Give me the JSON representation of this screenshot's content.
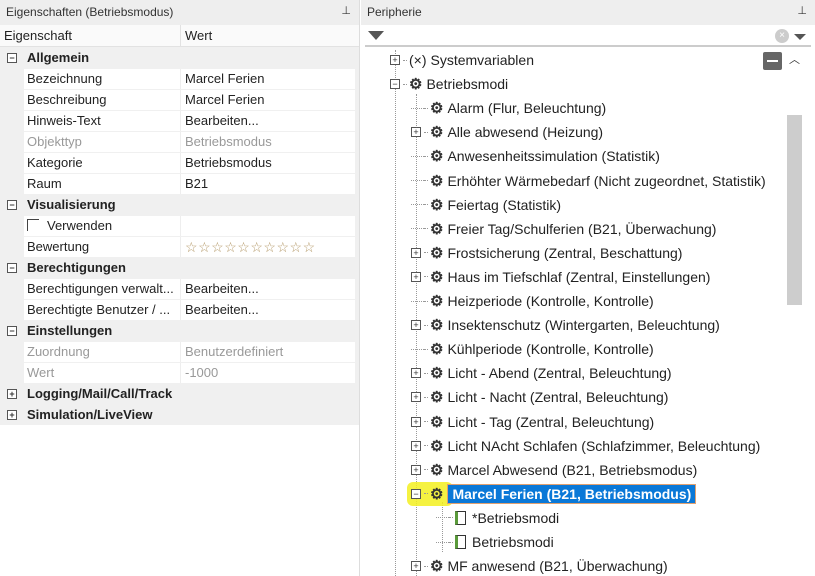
{
  "left": {
    "title": "Eigenschaften (Betriebsmodus)",
    "col_property": "Eigenschaft",
    "col_value": "Wert",
    "rows": [
      {
        "type": "cat",
        "label": "Allgemein",
        "exp": "−"
      },
      {
        "label": "Bezeichnung",
        "value": "Marcel Ferien"
      },
      {
        "label": "Beschreibung",
        "value": "Marcel Ferien"
      },
      {
        "label": "Hinweis-Text",
        "value": "Bearbeiten..."
      },
      {
        "label": "Objekttyp",
        "value": "Betriebsmodus",
        "dim": true
      },
      {
        "label": "Kategorie",
        "value": "Betriebsmodus"
      },
      {
        "label": "Raum",
        "value": "B21"
      },
      {
        "type": "cat",
        "label": "Visualisierung",
        "exp": "−"
      },
      {
        "type": "check",
        "label": "Verwenden",
        "checked": false
      },
      {
        "type": "stars",
        "label": "Bewertung",
        "value": 0,
        "max": 10
      },
      {
        "type": "cat",
        "label": "Berechtigungen",
        "exp": "−"
      },
      {
        "label": "Berechtigungen verwalt...",
        "value": "Bearbeiten..."
      },
      {
        "label": "Berechtigte Benutzer / ...",
        "value": "Bearbeiten..."
      },
      {
        "type": "cat",
        "label": "Einstellungen",
        "exp": "−"
      },
      {
        "label": "Zuordnung",
        "value": "Benutzerdefiniert",
        "dim": true
      },
      {
        "label": "Wert",
        "value": "-1000",
        "dim": true
      },
      {
        "type": "cat",
        "label": "Logging/Mail/Call/Track",
        "exp": "+"
      },
      {
        "type": "cat",
        "label": "Simulation/LiveView",
        "exp": "+"
      }
    ]
  },
  "right": {
    "title": "Peripherie",
    "filter_value": "",
    "tree": [
      {
        "level": 0,
        "exp": "+",
        "icon": "(×)",
        "label": "Systemvariablen"
      },
      {
        "level": 0,
        "exp": "−",
        "icon": "gear",
        "label": "Betriebsmodi"
      },
      {
        "level": 1,
        "exp": "",
        "icon": "gear",
        "label": "Alarm (Flur, Beleuchtung)"
      },
      {
        "level": 1,
        "exp": "+",
        "icon": "gear",
        "label": "Alle abwesend (Heizung)"
      },
      {
        "level": 1,
        "exp": "",
        "icon": "gear",
        "label": "Anwesenheitssimulation (Statistik)"
      },
      {
        "level": 1,
        "exp": "",
        "icon": "gear",
        "label": "Erhöhter Wärmebedarf (Nicht zugeordnet, Statistik)"
      },
      {
        "level": 1,
        "exp": "",
        "icon": "gear",
        "label": "Feiertag (Statistik)"
      },
      {
        "level": 1,
        "exp": "",
        "icon": "gear",
        "label": "Freier Tag/Schulferien (B21, Überwachung)"
      },
      {
        "level": 1,
        "exp": "+",
        "icon": "gear",
        "label": "Frostsicherung (Zentral, Beschattung)"
      },
      {
        "level": 1,
        "exp": "+",
        "icon": "gear",
        "label": "Haus im Tiefschlaf (Zentral, Einstellungen)"
      },
      {
        "level": 1,
        "exp": "",
        "icon": "gear",
        "label": "Heizperiode (Kontrolle, Kontrolle)"
      },
      {
        "level": 1,
        "exp": "+",
        "icon": "gear",
        "label": "Insektenschutz (Wintergarten, Beleuchtung)"
      },
      {
        "level": 1,
        "exp": "",
        "icon": "gear",
        "label": "Kühlperiode (Kontrolle, Kontrolle)"
      },
      {
        "level": 1,
        "exp": "+",
        "icon": "gear",
        "label": "Licht - Abend (Zentral, Beleuchtung)"
      },
      {
        "level": 1,
        "exp": "+",
        "icon": "gear",
        "label": "Licht - Nacht (Zentral, Beleuchtung)"
      },
      {
        "level": 1,
        "exp": "+",
        "icon": "gear",
        "label": "Licht - Tag (Zentral, Beleuchtung)"
      },
      {
        "level": 1,
        "exp": "+",
        "icon": "gear",
        "label": "Licht NAcht Schlafen (Schlafzimmer, Beleuchtung)"
      },
      {
        "level": 1,
        "exp": "+",
        "icon": "gear",
        "label": "Marcel Abwesend (B21, Betriebsmodus)"
      },
      {
        "level": 1,
        "exp": "−",
        "icon": "gear",
        "label": "Marcel Ferien (B21, Betriebsmodus)",
        "selected": true
      },
      {
        "level": 2,
        "exp": "",
        "icon": "file",
        "label": "*Betriebsmodi"
      },
      {
        "level": 2,
        "exp": "",
        "icon": "file",
        "label": "Betriebsmodi"
      },
      {
        "level": 1,
        "exp": "+",
        "icon": "gear",
        "label": "MF anwesend (B21, Überwachung)"
      }
    ]
  }
}
